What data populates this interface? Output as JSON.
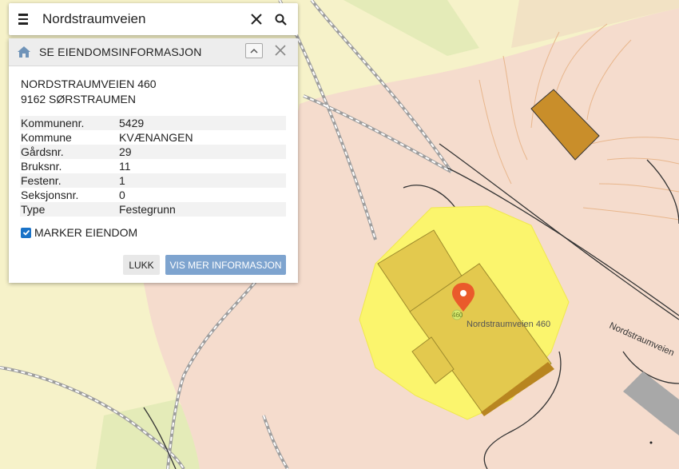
{
  "search": {
    "value": "Nordstraumveien"
  },
  "panel": {
    "title": "SE EIENDOMSINFORMASJON",
    "address_line1": "NORDSTRAUMVEIEN 460",
    "address_line2": "9162 SØRSTRAUMEN",
    "properties": [
      {
        "key": "Kommunenr.",
        "value": "5429"
      },
      {
        "key": "Kommune",
        "value": "KVÆNANGEN"
      },
      {
        "key": "Gårdsnr.",
        "value": "29"
      },
      {
        "key": "Bruksnr.",
        "value": "11"
      },
      {
        "key": "Festenr.",
        "value": "1"
      },
      {
        "key": "Seksjonsnr.",
        "value": "0"
      },
      {
        "key": "Type",
        "value": "Festegrunn"
      }
    ],
    "marker_label": "MARKER EIENDOM",
    "marker_checked": true,
    "close_label": "LUKK",
    "more_label": "VIS MER INFORMASJON"
  },
  "map": {
    "road_label_right": "Nordstraumveien",
    "address_label": "Nordstraumveien 460",
    "house_number": "460",
    "colors": {
      "background": "#f6f2c9",
      "residential": "#f5dccd",
      "forest": "#dfeab0",
      "highlight": "#fbf56d",
      "building": "#e3c94e",
      "building_brown": "#c98e2a",
      "pin": "#ea5a2b",
      "accent": "#1a73c8"
    }
  }
}
